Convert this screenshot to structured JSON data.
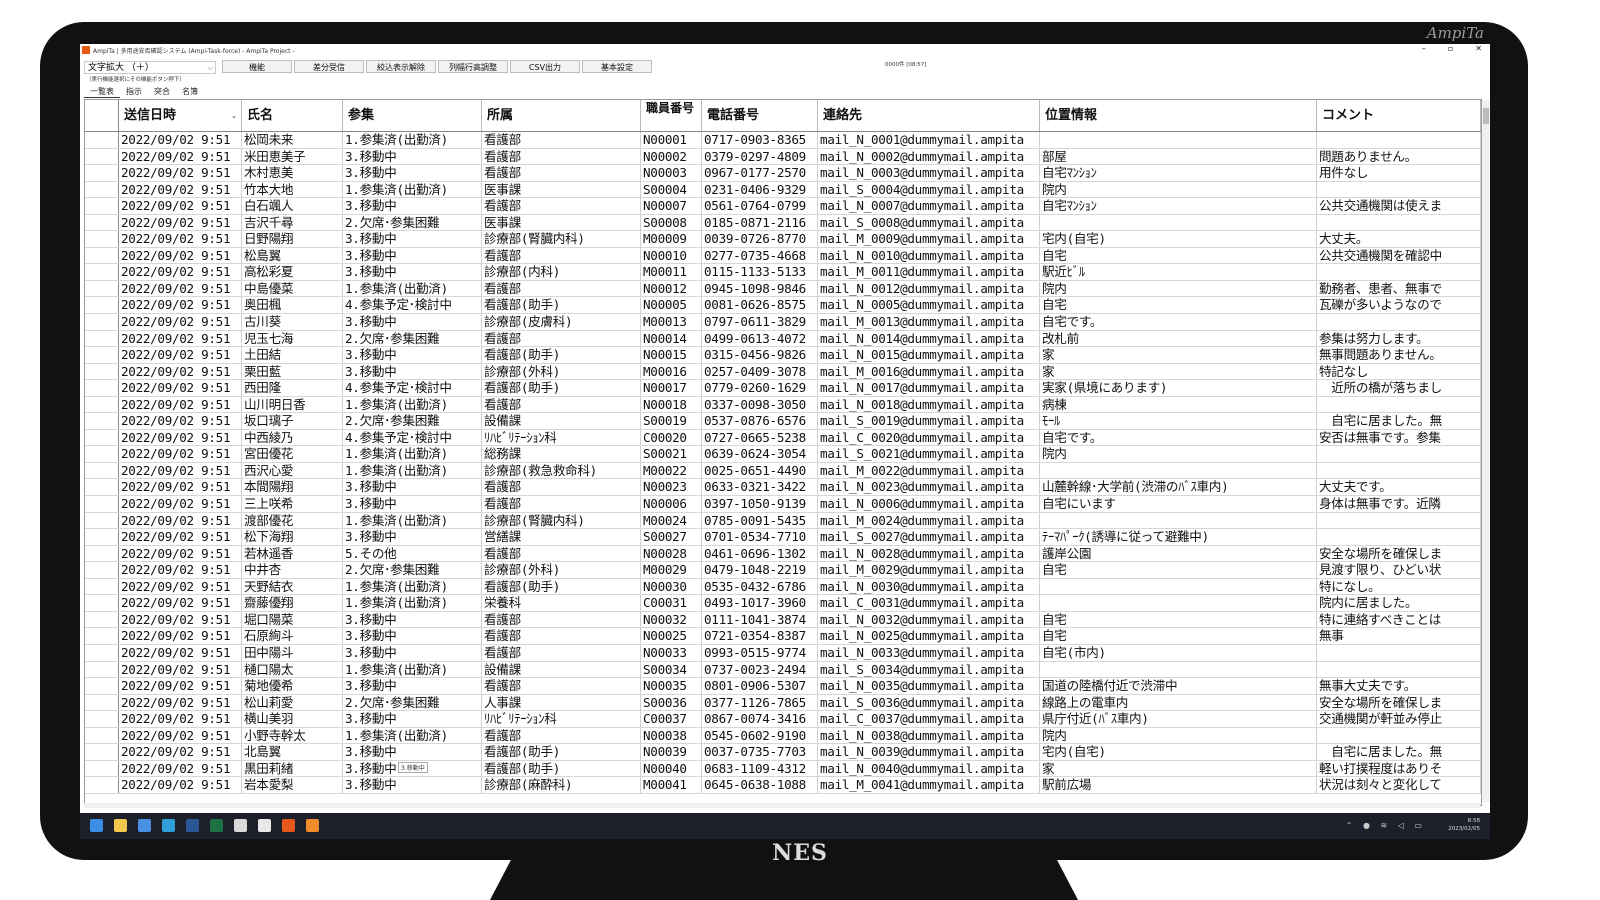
{
  "watermark": "AmpiTa",
  "brand": "NES",
  "window": {
    "title": "AmpiTa | 多用途安否確認システム (Ampi-Task-force) - AmpiTa Project -",
    "controls": [
      "–",
      "▫",
      "✕"
    ]
  },
  "toolbar": {
    "zoom_label": "文字拡大 （＋）",
    "zoom_hint": "（実行機能選択にその機能ボタン押下）",
    "buttons": [
      "機能",
      "差分受信",
      "絞込表示解除",
      "列幅行高調整",
      "CSV出力",
      "基本設定"
    ],
    "status_time": "0000件 [08:57]"
  },
  "tabs": [
    "一覧表",
    "指示",
    "突合",
    "名簿"
  ],
  "columns": [
    "送信日時",
    "氏名",
    "参集",
    "所属",
    "職員番号",
    "電話番号",
    "連絡先",
    "位置情報",
    "コメント"
  ],
  "rows": [
    [
      "2022/09/02 9:51",
      "松岡未来",
      "1.参集済(出勤済)",
      "看護部",
      "N00001",
      "0717-0903-8365",
      "mail_N_0001@dummymail.ampita",
      "",
      ""
    ],
    [
      "2022/09/02 9:51",
      "米田恵美子",
      "3.移動中",
      "看護部",
      "N00002",
      "0379-0297-4809",
      "mail_N_0002@dummymail.ampita",
      "部屋",
      "問題ありません。"
    ],
    [
      "2022/09/02 9:51",
      "木村恵美",
      "3.移動中",
      "看護部",
      "N00003",
      "0967-0177-2570",
      "mail_N_0003@dummymail.ampita",
      "自宅ﾏﾝｼｮﾝ",
      "用件なし"
    ],
    [
      "2022/09/02 9:51",
      "竹本大地",
      "1.参集済(出勤済)",
      "医事課",
      "S00004",
      "0231-0406-9329",
      "mail_S_0004@dummymail.ampita",
      "院内",
      ""
    ],
    [
      "2022/09/02 9:51",
      "白石颯人",
      "3.移動中",
      "看護部",
      "N00007",
      "0561-0764-0799",
      "mail_N_0007@dummymail.ampita",
      "自宅ﾏﾝｼｮﾝ",
      "公共交通機関は使えま"
    ],
    [
      "2022/09/02 9:51",
      "吉沢千尋",
      "2.欠席･参集困難",
      "医事課",
      "S00008",
      "0185-0871-2116",
      "mail_S_0008@dummymail.ampita",
      "",
      ""
    ],
    [
      "2022/09/02 9:51",
      "日野陽翔",
      "3.移動中",
      "診療部(腎臓内科)",
      "M00009",
      "0039-0726-8770",
      "mail_M_0009@dummymail.ampita",
      "宅内(自宅)",
      "大丈夫。"
    ],
    [
      "2022/09/02 9:51",
      "松島翼",
      "3.移動中",
      "看護部",
      "N00010",
      "0277-0735-4668",
      "mail_N_0010@dummymail.ampita",
      "自宅",
      "公共交通機関を確認中"
    ],
    [
      "2022/09/02 9:51",
      "高松彩夏",
      "3.移動中",
      "診療部(内科)",
      "M00011",
      "0115-1133-5133",
      "mail_M_0011@dummymail.ampita",
      "駅近ﾋﾞﾙ",
      ""
    ],
    [
      "2022/09/02 9:51",
      "中島優菜",
      "1.参集済(出勤済)",
      "看護部",
      "N00012",
      "0945-1098-9846",
      "mail_N_0012@dummymail.ampita",
      "院内",
      "勤務者、患者、無事で"
    ],
    [
      "2022/09/02 9:51",
      "奥田楓",
      "4.参集予定･検討中",
      "看護部(助手)",
      "N00005",
      "0081-0626-8575",
      "mail_N_0005@dummymail.ampita",
      "自宅",
      "瓦礫が多いようなので"
    ],
    [
      "2022/09/02 9:51",
      "古川葵",
      "3.移動中",
      "診療部(皮膚科)",
      "M00013",
      "0797-0611-3829",
      "mail_M_0013@dummymail.ampita",
      "自宅です。",
      ""
    ],
    [
      "2022/09/02 9:51",
      "児玉七海",
      "2.欠席･参集困難",
      "看護部",
      "N00014",
      "0499-0613-4072",
      "mail_N_0014@dummymail.ampita",
      "改札前",
      "参集は努力します。"
    ],
    [
      "2022/09/02 9:51",
      "土田結",
      "3.移動中",
      "看護部(助手)",
      "N00015",
      "0315-0456-9826",
      "mail_N_0015@dummymail.ampita",
      "家",
      "無事問題ありません。"
    ],
    [
      "2022/09/02 9:51",
      "栗田藍",
      "3.移動中",
      "診療部(外科)",
      "M00016",
      "0257-0409-3078",
      "mail_M_0016@dummymail.ampita",
      "家",
      "特記なし"
    ],
    [
      "2022/09/02 9:51",
      "西田隆",
      "4.参集予定･検討中",
      "看護部(助手)",
      "N00017",
      "0779-0260-1629",
      "mail_N_0017@dummymail.ampita",
      "実家(県境にあります)",
      "　近所の橋が落ちまし"
    ],
    [
      "2022/09/02 9:51",
      "山川明日香",
      "1.参集済(出勤済)",
      "看護部",
      "N00018",
      "0337-0098-3050",
      "mail_N_0018@dummymail.ampita",
      "病棟",
      ""
    ],
    [
      "2022/09/02 9:51",
      "坂口璃子",
      "2.欠席･参集困難",
      "設備課",
      "S00019",
      "0537-0876-6576",
      "mail_S_0019@dummymail.ampita",
      "ﾓｰﾙ",
      "　自宅に居ました。無"
    ],
    [
      "2022/09/02 9:51",
      "中西綾乃",
      "4.参集予定･検討中",
      "ﾘﾊﾋﾞﾘﾃｰｼｮﾝ科",
      "C00020",
      "0727-0665-5238",
      "mail_C_0020@dummymail.ampita",
      "自宅です。",
      "安否は無事です。参集"
    ],
    [
      "2022/09/02 9:51",
      "宮田優花",
      "1.参集済(出勤済)",
      "総務課",
      "S00021",
      "0639-0624-3054",
      "mail_S_0021@dummymail.ampita",
      "院内",
      ""
    ],
    [
      "2022/09/02 9:51",
      "西沢心愛",
      "1.参集済(出勤済)",
      "診療部(救急救命科)",
      "M00022",
      "0025-0651-4490",
      "mail_M_0022@dummymail.ampita",
      "",
      ""
    ],
    [
      "2022/09/02 9:51",
      "本間陽翔",
      "3.移動中",
      "看護部",
      "N00023",
      "0633-0321-3422",
      "mail_N_0023@dummymail.ampita",
      "山麓幹線･大学前(渋滞のﾊﾞｽ車内)",
      "大丈夫です。"
    ],
    [
      "2022/09/02 9:51",
      "三上咲希",
      "3.移動中",
      "看護部",
      "N00006",
      "0397-1050-9139",
      "mail_N_0006@dummymail.ampita",
      "自宅にいます",
      "身体は無事です。近隣"
    ],
    [
      "2022/09/02 9:51",
      "渡部優花",
      "1.参集済(出勤済)",
      "診療部(腎臓内科)",
      "M00024",
      "0785-0091-5435",
      "mail_M_0024@dummymail.ampita",
      "",
      ""
    ],
    [
      "2022/09/02 9:51",
      "松下海翔",
      "3.移動中",
      "営繕課",
      "S00027",
      "0701-0534-7710",
      "mail_S_0027@dummymail.ampita",
      "ﾃｰﾏﾊﾟｰｸ(誘導に従って避難中)",
      ""
    ],
    [
      "2022/09/02 9:51",
      "若林遥香",
      "5.その他",
      "看護部",
      "N00028",
      "0461-0696-1302",
      "mail_N_0028@dummymail.ampita",
      "護岸公園",
      "安全な場所を確保しま"
    ],
    [
      "2022/09/02 9:51",
      "中井杏",
      "2.欠席･参集困難",
      "診療部(外科)",
      "M00029",
      "0479-1048-2219",
      "mail_M_0029@dummymail.ampita",
      "自宅",
      "見渡す限り、ひどい状"
    ],
    [
      "2022/09/02 9:51",
      "天野結衣",
      "1.参集済(出勤済)",
      "看護部(助手)",
      "N00030",
      "0535-0432-6786",
      "mail_N_0030@dummymail.ampita",
      "",
      "特になし。"
    ],
    [
      "2022/09/02 9:51",
      "齋藤優翔",
      "1.参集済(出勤済)",
      "栄養科",
      "C00031",
      "0493-1017-3960",
      "mail_C_0031@dummymail.ampita",
      "",
      "院内に居ました。"
    ],
    [
      "2022/09/02 9:51",
      "堀口陽菜",
      "3.移動中",
      "看護部",
      "N00032",
      "0111-1041-3874",
      "mail_N_0032@dummymail.ampita",
      "自宅",
      "特に連絡すべきことは"
    ],
    [
      "2022/09/02 9:51",
      "石原絢斗",
      "3.移動中",
      "看護部",
      "N00025",
      "0721-0354-8387",
      "mail_N_0025@dummymail.ampita",
      "自宅",
      "無事"
    ],
    [
      "2022/09/02 9:51",
      "田中陽斗",
      "3.移動中",
      "看護部",
      "N00033",
      "0993-0515-9774",
      "mail_N_0033@dummymail.ampita",
      "自宅(市内)",
      ""
    ],
    [
      "2022/09/02 9:51",
      "樋口陽太",
      "1.参集済(出勤済)",
      "設備課",
      "S00034",
      "0737-0023-2494",
      "mail_S_0034@dummymail.ampita",
      "",
      ""
    ],
    [
      "2022/09/02 9:51",
      "菊地優希",
      "3.移動中",
      "看護部",
      "N00035",
      "0801-0906-5307",
      "mail_N_0035@dummymail.ampita",
      "国道の陸橋付近で渋滞中",
      "無事大丈夫です。"
    ],
    [
      "2022/09/02 9:51",
      "松山莉愛",
      "2.欠席･参集困難",
      "人事課",
      "S00036",
      "0377-1126-7865",
      "mail_S_0036@dummymail.ampita",
      "線路上の電車内",
      "安全な場所を確保しま"
    ],
    [
      "2022/09/02 9:51",
      "横山美羽",
      "3.移動中",
      "ﾘﾊﾋﾞﾘﾃｰｼｮﾝ科",
      "C00037",
      "0867-0074-3416",
      "mail_C_0037@dummymail.ampita",
      "県庁付近(ﾊﾞｽ車内)",
      "交通機関が軒並み停止"
    ],
    [
      "2022/09/02 9:51",
      "小野寺幹太",
      "1.参集済(出勤済)",
      "看護部",
      "N00038",
      "0545-0602-9190",
      "mail_N_0038@dummymail.ampita",
      "院内",
      ""
    ],
    [
      "2022/09/02 9:51",
      "北島翼",
      "3.移動中",
      "看護部(助手)",
      "N00039",
      "0037-0735-7703",
      "mail_N_0039@dummymail.ampita",
      "宅内(自宅)",
      "　自宅に居ました。無"
    ],
    [
      "2022/09/02 9:51",
      "黒田莉緒",
      "3.移動中",
      "看護部(助手)",
      "N00040",
      "0683-1109-4312",
      "mail_N_0040@dummymail.ampita",
      "家",
      "軽い打撲程度はありそ"
    ],
    [
      "2022/09/02 9:51",
      "岩本愛梨",
      "3.移動中",
      "診療部(麻酔科)",
      "M00041",
      "0645-0638-1088",
      "mail_M_0041@dummymail.ampita",
      "駅前広場",
      "状況は刻々と変化して"
    ]
  ],
  "tooltip": "3.移動中",
  "taskbar": {
    "time": "8:58",
    "date": "2023/02/05",
    "icons": [
      "start-icon",
      "folder-icon",
      "chat-icon",
      "browser-icon",
      "word-icon",
      "excel-icon",
      "pdf-icon",
      "chrome-icon",
      "app-icon",
      "ampita-icon"
    ],
    "colors": [
      "#3a8ee6",
      "#f2c94c",
      "#4a90e2",
      "#2f9fd8",
      "#2b5797",
      "#1e7145",
      "#d9d9d9",
      "#e8e8e8",
      "#e8581c",
      "#f08c2a"
    ]
  }
}
